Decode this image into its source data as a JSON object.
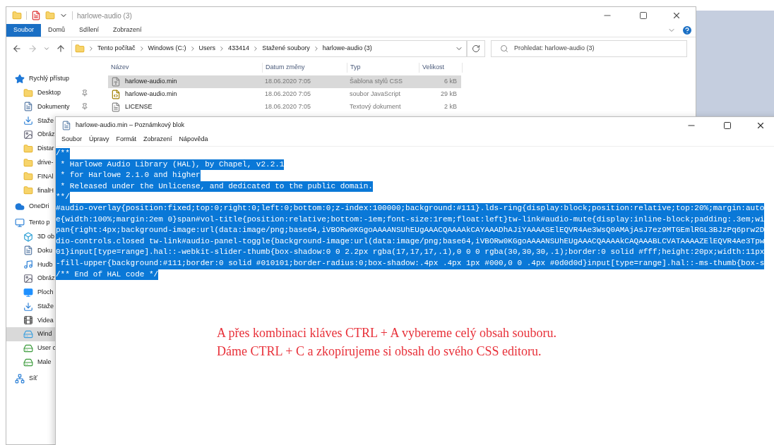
{
  "explorer": {
    "title": "harlowe-audio (3)",
    "ribbon_tabs": [
      {
        "label": "Soubor",
        "selected": true
      },
      {
        "label": "Domů",
        "selected": false
      },
      {
        "label": "Sdílení",
        "selected": false
      },
      {
        "label": "Zobrazení",
        "selected": false
      }
    ],
    "breadcrumbs": [
      "Tento počítač",
      "Windows (C:)",
      "Users",
      "433414",
      "Stažené soubory",
      "harlowe-audio (3)"
    ],
    "search": {
      "placeholder": "Prohledat: harlowe-audio (3)"
    },
    "sidebar": [
      {
        "label": "Rychlý přístup",
        "kind": "star",
        "pinned": false,
        "selected": false
      },
      {
        "label": "Desktop",
        "kind": "folder",
        "pinned": true,
        "selected": false
      },
      {
        "label": "Dokumenty",
        "kind": "document",
        "pinned": true,
        "selected": false
      },
      {
        "label": "Staže",
        "kind": "download",
        "pinned": false,
        "selected": false
      },
      {
        "label": "Obráz",
        "kind": "picture",
        "pinned": false,
        "selected": false
      },
      {
        "label": "Distar",
        "kind": "folder",
        "pinned": false,
        "selected": false
      },
      {
        "label": "drive-",
        "kind": "folder",
        "pinned": false,
        "selected": false
      },
      {
        "label": "FINAl",
        "kind": "folder",
        "pinned": false,
        "selected": false
      },
      {
        "label": "finalH",
        "kind": "folder",
        "pinned": false,
        "selected": false
      },
      {
        "label": "OneDri",
        "kind": "cloud",
        "pinned": false,
        "selected": false
      },
      {
        "label": "Tento p",
        "kind": "computer",
        "pinned": false,
        "selected": false
      },
      {
        "label": "3D ob",
        "kind": "cube",
        "pinned": false,
        "selected": false
      },
      {
        "label": "Doku",
        "kind": "document",
        "pinned": false,
        "selected": false
      },
      {
        "label": "Hudb",
        "kind": "music",
        "pinned": false,
        "selected": false
      },
      {
        "label": "Obráz",
        "kind": "picture",
        "pinned": false,
        "selected": false
      },
      {
        "label": "Ploch",
        "kind": "desktop",
        "pinned": false,
        "selected": false
      },
      {
        "label": "Staže",
        "kind": "download",
        "pinned": false,
        "selected": false
      },
      {
        "label": "Videa",
        "kind": "video",
        "pinned": false,
        "selected": false
      },
      {
        "label": "Wind",
        "kind": "drive",
        "pinned": false,
        "selected": true
      },
      {
        "label": "User c",
        "kind": "network-drive",
        "pinned": false,
        "selected": false
      },
      {
        "label": "Male",
        "kind": "network-drive",
        "pinned": false,
        "selected": false
      },
      {
        "label": "Síť",
        "kind": "network",
        "pinned": false,
        "selected": false
      }
    ],
    "columns": [
      "Název",
      "Datum změny",
      "Typ",
      "Velikost"
    ],
    "files": [
      {
        "name": "harlowe-audio.min",
        "date": "18.06.2020 7:05",
        "type": "Šablona stylů CSS",
        "size": "6 kB",
        "kind": "css",
        "selected": true
      },
      {
        "name": "harlowe-audio.min",
        "date": "18.06.2020 7:05",
        "type": "soubor JavaScript",
        "size": "29 kB",
        "kind": "js",
        "selected": false
      },
      {
        "name": "LICENSE",
        "date": "18.06.2020 7:05",
        "type": "Textový dokument",
        "size": "2 kB",
        "kind": "text",
        "selected": false
      }
    ]
  },
  "notepad": {
    "title": "harlowe-audio.min – Poznámkový blok",
    "menu": [
      "Soubor",
      "Úpravy",
      "Formát",
      "Zobrazení",
      "Nápověda"
    ],
    "lines": [
      "/**",
      " * Harlowe Audio Library (HAL), by Chapel, v2.2.1",
      " * for Harlowe 2.1.0 and higher",
      " * Released under the Unlicense, and dedicated to the public domain.",
      "**/",
      "#audio-overlay{position:fixed;top:0;right:0;left:0;bottom:0;z-index:100000;background:#111}.lds-ring{display:block;position:relative;top:20%;margin:auto",
      "e{width:100%;margin:2em 0}span#vol-title{position:relative;bottom:-1em;font-size:1rem;float:left}tw-link#audio-mute{display:inline-block;padding:.3em;wi",
      "pan{right:4px;background-image:url(data:image/png;base64,iVBORw0KGgoAAAANSUhEUgAAACQAAAAkCAYAAADhAJiYAAAASElEQVR4Ae3WsQ0AMAjAsJ7ez9MTGEmlRGL3BJzPq6prw2D",
      "dio-controls.closed tw-link#audio-panel-toggle{background-image:url(data:image/png;base64,iVBORw0KGgoAAAANSUhEUgAAACQAAAAkCAQAAABLCVATAAAAZElEQVR4Ae3Tpw",
      "01}input[type=range].hal::-webkit-slider-thumb{box-shadow:0 0 2.2px rgba(17,17,17,.1),0 0 0 rgba(30,30,30,.1);border:0 solid #fff;height:20px;width:11px",
      "-fill-upper{background:#111;border:0 solid #010101;border-radius:0;box-shadow:.4px .4px 1px #000,0 0 .4px #0d0d0d}input[type=range].hal::-ms-thumb{box-s",
      "/** End of HAL code */"
    ],
    "selected": true
  },
  "annotation": "A přes kombinaci kláves CTRL + A vybereme celý obsah souboru. Dáme CTRL + C a zkopírujeme si obsah do svého CSS editoru."
}
